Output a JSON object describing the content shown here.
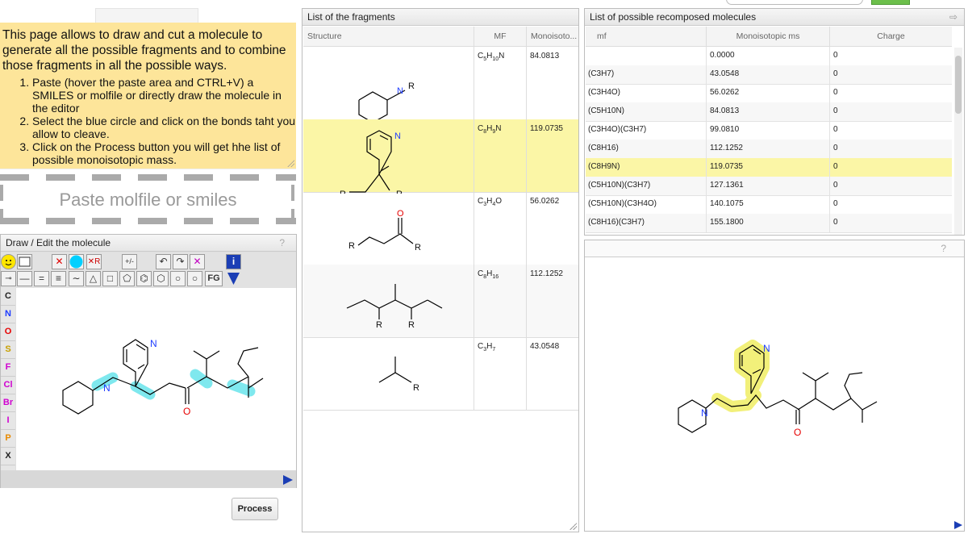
{
  "instructions": {
    "intro": "This page allows to draw and cut a molecule to generate all the possible fragments and to combine those fragments in all the possible ways.",
    "steps": [
      "Paste (hover the paste area and CTRL+V) a SMILES or molfile or directly draw the molecule in the editor",
      "Select the blue circle and click on the bonds taht you allow to cleave.",
      "Click on the Process button you will get hhe list of possible monoisotopic mass."
    ]
  },
  "paste_area": {
    "label": "Paste molfile or smiles"
  },
  "draw_panel": {
    "title": "Draw / Edit the molecule",
    "help": "?",
    "fg_label": "FG",
    "elements": [
      "C",
      "N",
      "O",
      "S",
      "F",
      "Cl",
      "Br",
      "I",
      "P",
      "X"
    ],
    "element_colors": [
      "#222222",
      "#1e3cff",
      "#e60000",
      "#c8a000",
      "#d000d0",
      "#d000d0",
      "#d000d0",
      "#d000d0",
      "#e88a00",
      "#222222"
    ]
  },
  "process_button": {
    "label": "Process"
  },
  "fragments_panel": {
    "title": "List of the fragments",
    "columns": [
      "Structure",
      "MF",
      "Monoisoto..."
    ],
    "rows": [
      {
        "mf_base": "C",
        "mf_sub1": "5",
        "mf_mid": "H",
        "mf_sub2": "10",
        "mf_tail": "N",
        "mass": "84.0813",
        "selected": false
      },
      {
        "mf_base": "C",
        "mf_sub1": "8",
        "mf_mid": "H",
        "mf_sub2": "9",
        "mf_tail": "N",
        "mass": "119.0735",
        "selected": true
      },
      {
        "mf_base": "C",
        "mf_sub1": "3",
        "mf_mid": "H",
        "mf_sub2": "4",
        "mf_tail": "O",
        "mass": "56.0262",
        "selected": false
      },
      {
        "mf_base": "C",
        "mf_sub1": "8",
        "mf_mid": "H",
        "mf_sub2": "16",
        "mf_tail": "",
        "mass": "112.1252",
        "selected": false
      },
      {
        "mf_base": "C",
        "mf_sub1": "3",
        "mf_mid": "H",
        "mf_sub2": "7",
        "mf_tail": "",
        "mass": "43.0548",
        "selected": false
      }
    ],
    "atom_labels": {
      "r": "R",
      "n": "N",
      "o": "O"
    }
  },
  "recomposed_panel": {
    "title": "List of possible recomposed molecules",
    "columns": [
      "mf",
      "Monoisotopic ms",
      "Charge"
    ],
    "rows": [
      {
        "mf": "",
        "ms": "0.0000",
        "charge": "0",
        "selected": false
      },
      {
        "mf": "(C3H7)",
        "ms": "43.0548",
        "charge": "0",
        "selected": false
      },
      {
        "mf": "(C3H4O)",
        "ms": "56.0262",
        "charge": "0",
        "selected": false
      },
      {
        "mf": "(C5H10N)",
        "ms": "84.0813",
        "charge": "0",
        "selected": false
      },
      {
        "mf": "(C3H4O)(C3H7)",
        "ms": "99.0810",
        "charge": "0",
        "selected": false
      },
      {
        "mf": "(C8H16)",
        "ms": "112.1252",
        "charge": "0",
        "selected": false
      },
      {
        "mf": "(C8H9N)",
        "ms": "119.0735",
        "charge": "0",
        "selected": true
      },
      {
        "mf": "(C5H10N)(C3H7)",
        "ms": "127.1361",
        "charge": "0",
        "selected": false
      },
      {
        "mf": "(C5H10N)(C3H4O)",
        "ms": "140.1075",
        "charge": "0",
        "selected": false
      },
      {
        "mf": "(C8H16)(C3H7)",
        "ms": "155.1800",
        "charge": "0",
        "selected": false
      }
    ]
  },
  "viewer_panel": {
    "help": "?"
  },
  "colors": {
    "instructions_bg": "#fde59a",
    "selected_row": "#fbf6a6",
    "highlight_cyan": "#7fe8ee",
    "highlight_yellow": "#f2f07a",
    "process_green": "#6cbf4b"
  }
}
